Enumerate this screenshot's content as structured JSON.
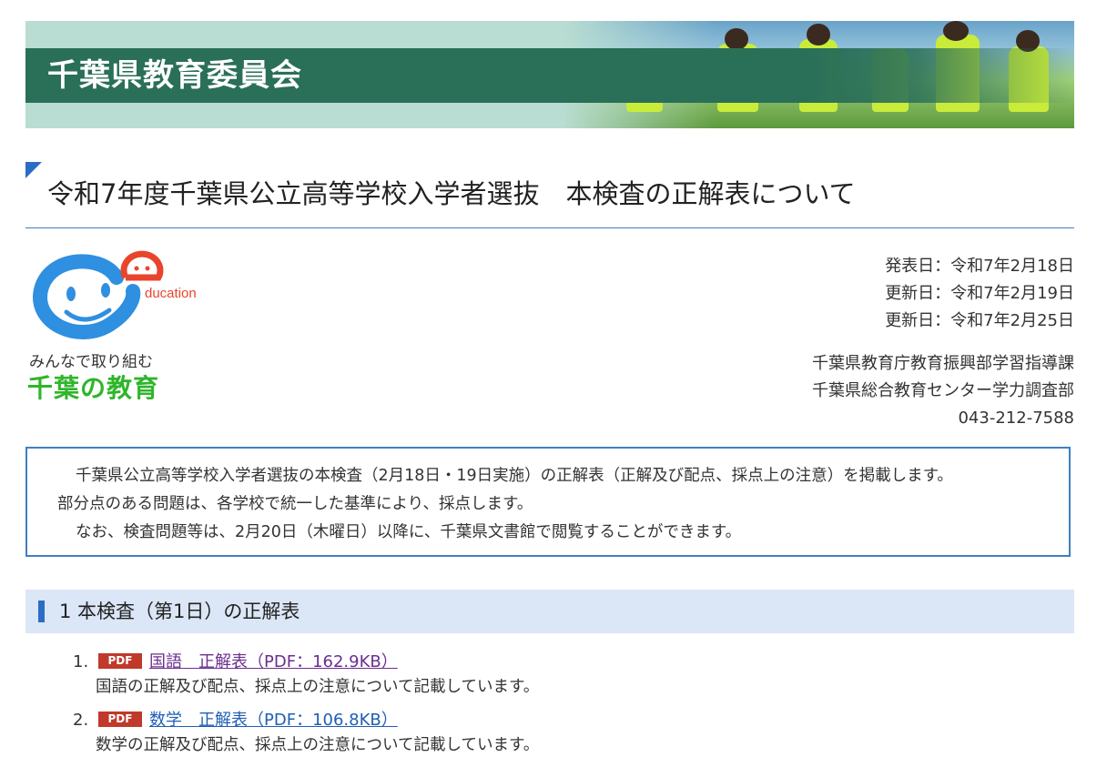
{
  "banner": {
    "title": "千葉県教育委員会"
  },
  "page": {
    "title": "令和7年度千葉県公立高等学校入学者選抜　本検査の正解表について"
  },
  "logo": {
    "caption": "みんなで取り組む",
    "name": "千葉の教育",
    "mark_text": "ducation"
  },
  "meta": {
    "published": "発表日：令和7年2月18日",
    "updated1": "更新日：令和7年2月19日",
    "updated2": "更新日：令和7年2月25日",
    "dept1": "千葉県教育庁教育振興部学習指導課",
    "dept2": "千葉県総合教育センター学力調査部",
    "phone": "043-212-7588"
  },
  "notice": {
    "line1": "千葉県公立高等学校入学者選抜の本検査（2月18日・19日実施）の正解表（正解及び配点、採点上の注意）を掲載します。",
    "line2": "部分点のある問題は、各学校で統一した基準により、採点します。",
    "line3": "なお、検査問題等は、2月20日（木曜日）以降に、千葉県文書館で閲覧することができます。"
  },
  "section1": {
    "title": "1 本検査（第1日）の正解表"
  },
  "items": [
    {
      "num": "1.",
      "badge": "PDF",
      "link": "国語　正解表（PDF：162.9KB）",
      "desc": "国語の正解及び配点、採点上の注意について記載しています。",
      "link_color": "#6b2f8f"
    },
    {
      "num": "2.",
      "badge": "PDF",
      "link": "数学　正解表（PDF：106.8KB）",
      "desc": "数学の正解及び配点、採点上の注意について記載しています。",
      "link_color": "#1f5fb5"
    }
  ],
  "colors": {
    "accent": "#2b6cc4",
    "banner_green": "#2a6f58",
    "pdf_badge": "#c0392b"
  }
}
